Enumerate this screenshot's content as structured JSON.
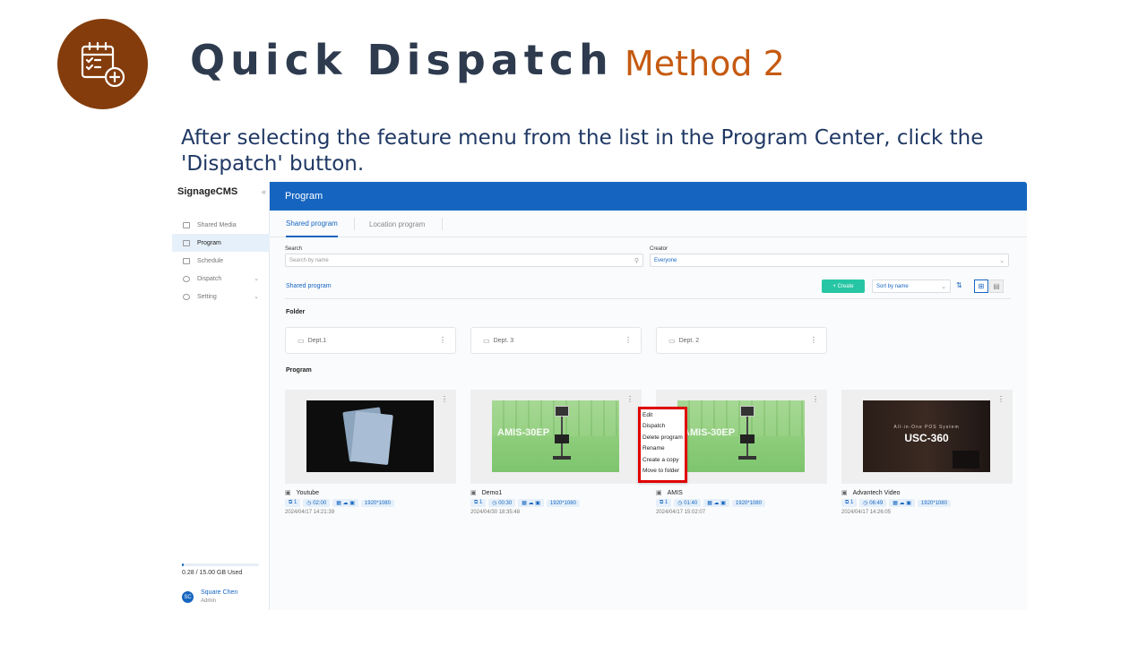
{
  "slide": {
    "title": "Quick Dispatch",
    "method": "Method 2",
    "description": "After selecting the feature menu from the list in the Program Center, click the 'Dispatch' button."
  },
  "app": {
    "brand": "SignageCMS",
    "header_title": "Program",
    "sidebar": {
      "items": [
        {
          "label": "Shared Media",
          "icon": "image-icon",
          "active": false
        },
        {
          "label": "Program",
          "icon": "program-icon",
          "active": true
        },
        {
          "label": "Schedule",
          "icon": "calendar-icon",
          "active": false
        },
        {
          "label": "Dispatch",
          "icon": "dispatch-icon",
          "active": false,
          "expandable": true
        },
        {
          "label": "Setting",
          "icon": "gear-icon",
          "active": false,
          "expandable": true
        }
      ],
      "storage_text": "0.28 / 15.00 GB Used",
      "storage_fraction": 0.019,
      "user": {
        "initials": "SC",
        "name": "Square Chen",
        "role": "Admin"
      }
    },
    "tabs": [
      {
        "label": "Shared program",
        "active": true
      },
      {
        "label": "Location program",
        "active": false
      }
    ],
    "filters": {
      "search_label": "Search",
      "search_placeholder": "Search by name",
      "creator_label": "Creator",
      "creator_value": "Everyone"
    },
    "breadcrumb": "Shared program",
    "toolbar": {
      "create_label": "+ Create",
      "sort_value": "Sort by name"
    },
    "folder_heading": "Folder",
    "folders": [
      "Dept.1",
      "Dept. 3",
      "Dept. 2"
    ],
    "program_heading": "Program",
    "programs": [
      {
        "name": "Youtube",
        "pages": "1",
        "duration": "02:00",
        "resolution": "1920*1080",
        "date": "2024/04/17 14:21:39"
      },
      {
        "name": "Demo1",
        "pages": "1",
        "duration": "00:30",
        "resolution": "1920*1080",
        "date": "2024/04/30 18:35:48"
      },
      {
        "name": "AMIS",
        "pages": "1",
        "duration": "01:40",
        "resolution": "1920*1080",
        "date": "2024/04/17 15:02:07"
      },
      {
        "name": "Advantech Video",
        "pages": "1",
        "duration": "06:49",
        "resolution": "1920*1080",
        "date": "2024/04/17 14:26:05"
      }
    ],
    "thumbnails": {
      "amis_text": "AMIS-30EP",
      "usc_sub": "All-in-One POS System",
      "usc_title": "USC-360"
    },
    "context_menu": [
      "Edit",
      "Dispatch",
      "Delete program",
      "Rename",
      "Create a copy",
      "Move to folder"
    ],
    "colors": {
      "primary": "#1565c0",
      "accent": "#26c6a4",
      "highlight": "#e00000",
      "logo_bg": "#843c0c"
    }
  }
}
